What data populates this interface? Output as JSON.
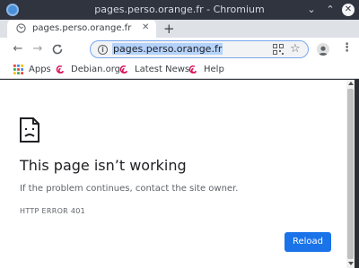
{
  "window": {
    "title": "pages.perso.orange.fr - Chromium",
    "minimize_glyph": "⌄",
    "maximize_glyph": "⌃",
    "close_glyph": "✕"
  },
  "tab": {
    "title": "pages.perso.orange.fr",
    "close_glyph": "✕",
    "new_tab_glyph": "+"
  },
  "toolbar": {
    "back_glyph": "←",
    "forward_glyph": "→",
    "reload_glyph": "C",
    "url": "pages.perso.orange.fr",
    "info_glyph": "i",
    "star_glyph": "☆",
    "menu_glyph": "⋮"
  },
  "bookmarks": [
    {
      "label": "Apps",
      "icon": "apps-grid-icon"
    },
    {
      "label": "Debian.org",
      "icon": "debian-swirl-icon"
    },
    {
      "label": "Latest News",
      "icon": "debian-swirl-icon"
    },
    {
      "label": "Help",
      "icon": "debian-swirl-icon"
    }
  ],
  "error": {
    "title": "This page isn’t working",
    "description": "If the problem continues, contact the site owner.",
    "code": "HTTP ERROR 401",
    "reload_label": "Reload"
  },
  "colors": {
    "accent": "#1a73e8",
    "titlebar": "#2f343f",
    "tabstrip": "#dee1e6",
    "url_highlight": "#b4d2fb"
  }
}
